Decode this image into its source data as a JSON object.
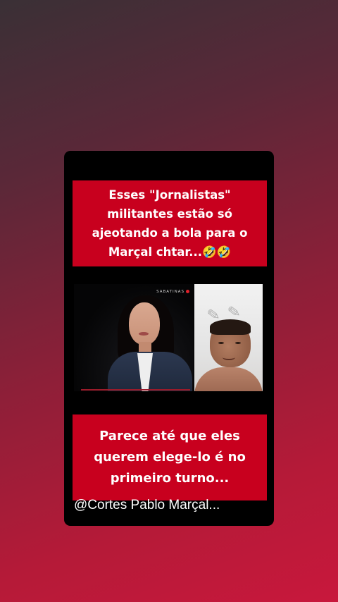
{
  "story": {
    "caption_top": "Esses \"Jornalistas\"\nmilitantes estão só\najeotando a bola para o\nMarçal chtar...🤣🤣",
    "caption_bottom": "Parece até que eles\nquerem elege-lo é  no\nprimeiro turno...",
    "watermark": "@Cortes Pablo Marçal...",
    "video": {
      "overlay_label": "SABATINAS"
    }
  },
  "colors": {
    "caption_bg": "#c8001e",
    "card_bg": "#000000",
    "bg_top": "#3a3036",
    "bg_bottom": "#c8183c"
  }
}
